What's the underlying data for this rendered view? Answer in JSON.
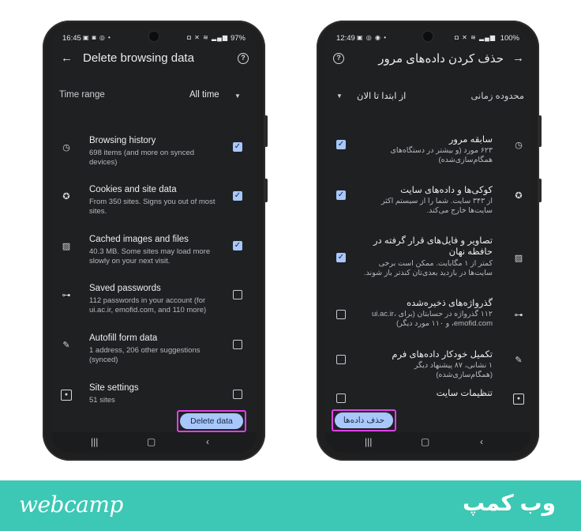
{
  "left_phone": {
    "status": {
      "time": "16:45",
      "battery": "97%"
    },
    "title": "Delete browsing data",
    "time_range": {
      "label": "Time range",
      "value": "All time"
    },
    "items": [
      {
        "title": "Browsing history",
        "sub": "698 items (and more on synced devices)",
        "icon": "clock-icon",
        "checked": true
      },
      {
        "title": "Cookies and site data",
        "sub": "From 350 sites. Signs you out of most sites.",
        "icon": "cookie-icon",
        "checked": true
      },
      {
        "title": "Cached images and files",
        "sub": "40.3 MB. Some sites may load more slowly on your next visit.",
        "icon": "image-icon",
        "checked": true
      },
      {
        "title": "Saved passwords",
        "sub": "112 passwords in your account (for ui.ac.ir, emofid.com, and 110 more)",
        "icon": "key-icon",
        "checked": false
      },
      {
        "title": "Autofill form data",
        "sub": "1 address, 206 other suggestions (synced)",
        "icon": "pencil-icon",
        "checked": false
      },
      {
        "title": "Site settings",
        "sub": "51 sites",
        "icon": "site-settings-icon",
        "checked": false
      }
    ],
    "delete_label": "Delete data"
  },
  "right_phone": {
    "status": {
      "time": "12:49",
      "battery": "100%"
    },
    "title": "حذف کردن داده‌های مرور",
    "time_range": {
      "label": "محدوده زمانی",
      "value": "از ابتدا تا الان"
    },
    "items": [
      {
        "title": "سابقه مرور",
        "sub": "۶۲۳ مورد (و بیشتر در دستگاه‌های همگام‌سازی‌شده)",
        "icon": "clock-icon",
        "checked": true
      },
      {
        "title": "کوکی‌ها و داده‌های سایت",
        "sub": "از ۳۴۳ سایت. شما را از سیستم اکثر سایت‌ها خارج می‌کند.",
        "icon": "cookie-icon",
        "checked": true
      },
      {
        "title": "تصاویر و فایل‌های قرار گرفته در حافظه نهان",
        "sub": "کمتر از ۱ مگابایت. ممکن است برخی سایت‌ها در بازدید بعدی‌تان کندتر باز شوند.",
        "icon": "image-icon",
        "checked": true
      },
      {
        "title": "گذرواژه‌های ذخیره‌شده",
        "sub": "۱۱۲ گذرواژه در حسابتان (برای ui.ac.ir، emofid.com، و ۱۱۰ مورد دیگر)",
        "icon": "key-icon",
        "checked": false
      },
      {
        "title": "تکمیل خودکار داده‌های فرم",
        "sub": "۱ نشانی، ۸۷ پیشنهاد دیگر (همگام‌سازی‌شده)",
        "icon": "pencil-icon",
        "checked": false
      },
      {
        "title": "تنظیمات سایت",
        "sub": "",
        "icon": "site-settings-icon",
        "checked": false
      }
    ],
    "delete_label": "حذف داده‌ها"
  },
  "footer": {
    "brand_en": "webcamp",
    "brand_fa": "وب کمپ"
  },
  "colors": {
    "accent": "#a8c7fa",
    "highlight": "#e040e8",
    "footer_bg": "#3cc8b4",
    "screen_bg": "#1f2022"
  }
}
